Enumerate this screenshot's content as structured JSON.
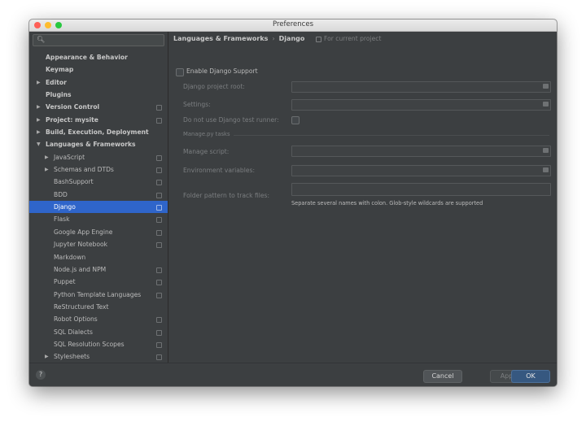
{
  "window": {
    "title": "Preferences"
  },
  "search": {
    "placeholder": ""
  },
  "sidebar": {
    "items": [
      {
        "label": "Appearance & Behavior",
        "level": 0,
        "arrow": "",
        "bold": true,
        "scope": false
      },
      {
        "label": "Keymap",
        "level": 0,
        "arrow": "",
        "bold": true,
        "scope": false
      },
      {
        "label": "Editor",
        "level": 0,
        "arrow": "▶",
        "bold": true,
        "scope": false
      },
      {
        "label": "Plugins",
        "level": 0,
        "arrow": "",
        "bold": true,
        "scope": false
      },
      {
        "label": "Version Control",
        "level": 0,
        "arrow": "▶",
        "bold": true,
        "scope": true
      },
      {
        "label": "Project: mysite",
        "level": 0,
        "arrow": "▶",
        "bold": true,
        "scope": true
      },
      {
        "label": "Build, Execution, Deployment",
        "level": 0,
        "arrow": "▶",
        "bold": true,
        "scope": false
      },
      {
        "label": "Languages & Frameworks",
        "level": 0,
        "arrow": "▼",
        "bold": true,
        "scope": false
      },
      {
        "label": "JavaScript",
        "level": 1,
        "arrow": "▶",
        "bold": false,
        "scope": true
      },
      {
        "label": "Schemas and DTDs",
        "level": 1,
        "arrow": "▶",
        "bold": false,
        "scope": true
      },
      {
        "label": "BashSupport",
        "level": 1,
        "arrow": "",
        "bold": false,
        "scope": true
      },
      {
        "label": "BDD",
        "level": 1,
        "arrow": "",
        "bold": false,
        "scope": true
      },
      {
        "label": "Django",
        "level": 1,
        "arrow": "",
        "bold": false,
        "scope": true,
        "selected": true
      },
      {
        "label": "Flask",
        "level": 1,
        "arrow": "",
        "bold": false,
        "scope": true
      },
      {
        "label": "Google App Engine",
        "level": 1,
        "arrow": "",
        "bold": false,
        "scope": true
      },
      {
        "label": "Jupyter Notebook",
        "level": 1,
        "arrow": "",
        "bold": false,
        "scope": true
      },
      {
        "label": "Markdown",
        "level": 1,
        "arrow": "",
        "bold": false,
        "scope": false
      },
      {
        "label": "Node.js and NPM",
        "level": 1,
        "arrow": "",
        "bold": false,
        "scope": true
      },
      {
        "label": "Puppet",
        "level": 1,
        "arrow": "",
        "bold": false,
        "scope": true
      },
      {
        "label": "Python Template Languages",
        "level": 1,
        "arrow": "",
        "bold": false,
        "scope": true
      },
      {
        "label": "ReStructured Text",
        "level": 1,
        "arrow": "",
        "bold": false,
        "scope": false
      },
      {
        "label": "Robot Options",
        "level": 1,
        "arrow": "",
        "bold": false,
        "scope": true
      },
      {
        "label": "SQL Dialects",
        "level": 1,
        "arrow": "",
        "bold": false,
        "scope": true
      },
      {
        "label": "SQL Resolution Scopes",
        "level": 1,
        "arrow": "",
        "bold": false,
        "scope": true
      },
      {
        "label": "Stylesheets",
        "level": 1,
        "arrow": "▶",
        "bold": false,
        "scope": true
      }
    ]
  },
  "content": {
    "breadcrumb": {
      "parent": "Languages & Frameworks",
      "separator": "›",
      "current": "Django"
    },
    "scope_label": "For current project",
    "enable_label": "Enable Django Support",
    "project_root_label": "Django project root:",
    "settings_label": "Settings:",
    "no_test_runner_label": "Do not use Django test runner:",
    "group_label": "Manage.py tasks",
    "manage_script_label": "Manage script:",
    "env_vars_label": "Environment variables:",
    "folder_pattern_label": "Folder pattern to track files:",
    "folder_pattern_hint": "Separate several names with colon. Glob-style wildcards are supported"
  },
  "footer": {
    "help_label": "?",
    "cancel_label": "Cancel",
    "apply_label": "Apply",
    "ok_label": "OK"
  }
}
